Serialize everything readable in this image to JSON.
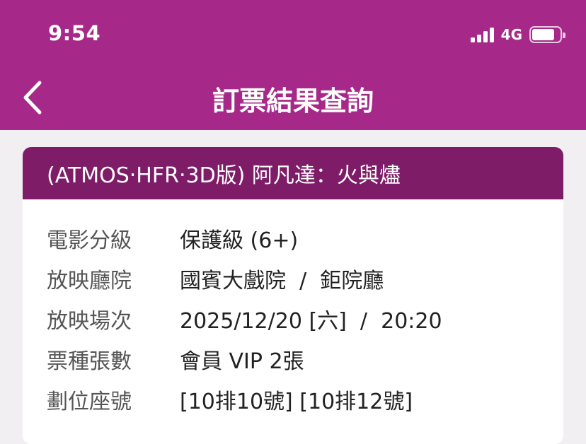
{
  "status_bar": {
    "time": "9:54",
    "network": "4G",
    "icons": [
      "signal-icon",
      "battery-icon"
    ]
  },
  "nav": {
    "title": "訂票結果查詢",
    "back_icon": "chevron-left-icon"
  },
  "colors": {
    "header_bg": "#a6298a",
    "card_header_bg": "#7e1c68",
    "page_bg": "#f2eff2"
  },
  "ticket": {
    "movie_title": "(ATMOS‧HFR‧3D版) 阿凡達：火與燼",
    "rows": [
      {
        "label": "電影分級",
        "value": "保護級 (6+)"
      },
      {
        "label": "放映廳院",
        "value": "國賓大戲院  /  鉅院廳"
      },
      {
        "label": "放映場次",
        "value": "2025/12/20 [六]  /  20:20"
      },
      {
        "label": "票種張數",
        "value": "會員 VIP 2張"
      },
      {
        "label": "劃位座號",
        "value": "[10排10號] [10排12號]"
      }
    ]
  }
}
